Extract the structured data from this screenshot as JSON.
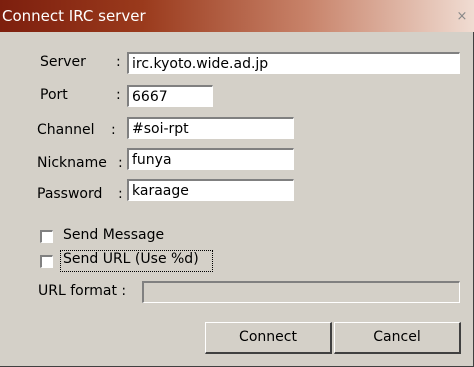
{
  "window": {
    "title": "Connect IRC server",
    "close_glyph": "×"
  },
  "form": {
    "server_label": "Server",
    "server_value": "irc.kyoto.wide.ad.jp",
    "port_label": "Port",
    "port_value": "6667",
    "channel_label": "Channel",
    "channel_value": "#soi-rpt",
    "nickname_label": "Nickname",
    "nickname_value": "funya",
    "password_label": "Password",
    "password_value": "karaage",
    "colon": ":"
  },
  "options": {
    "send_message_label": "Send Message",
    "send_message_checked": false,
    "send_url_label": "Send URL (Use %d)",
    "send_url_checked": false,
    "url_format_label": "URL format :",
    "url_format_value": ""
  },
  "buttons": {
    "connect": "Connect",
    "cancel": "Cancel"
  }
}
